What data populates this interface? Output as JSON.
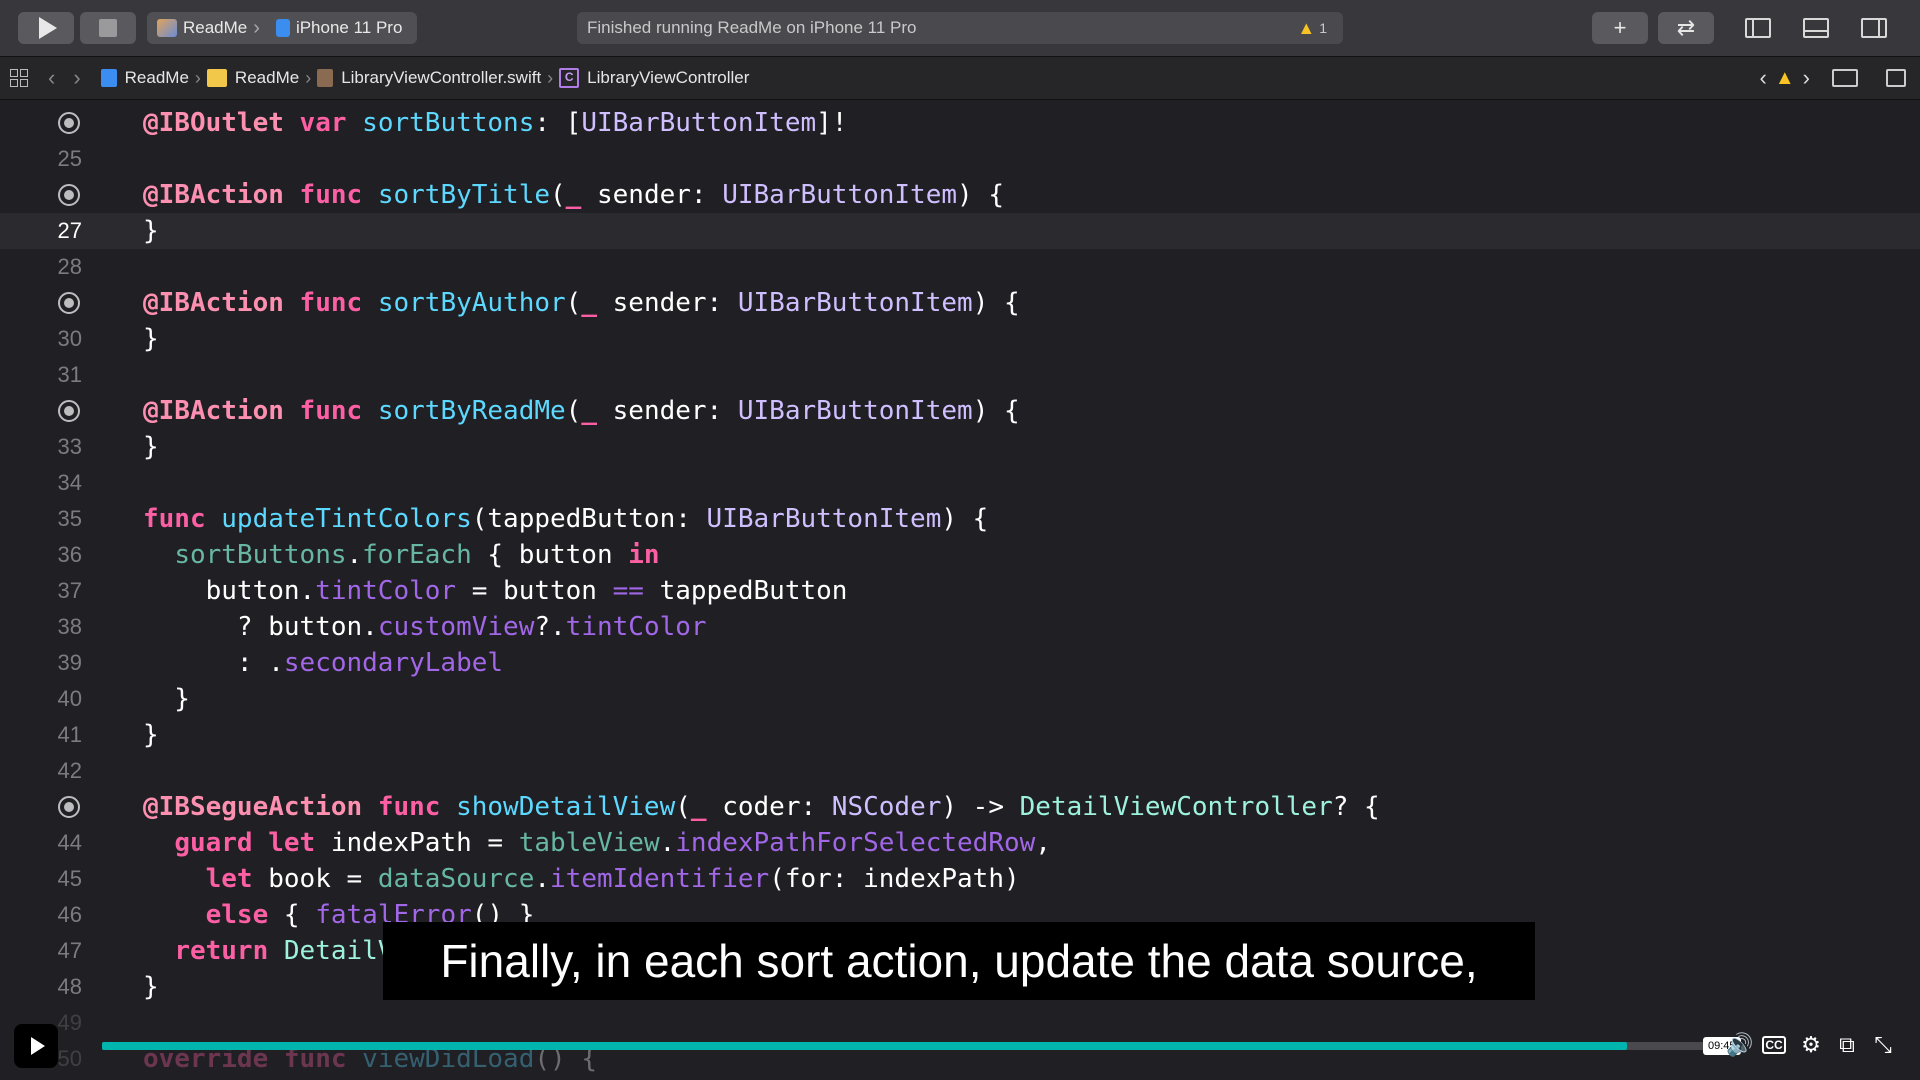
{
  "toolbar": {
    "scheme_project": "ReadMe",
    "scheme_device": "iPhone 11 Pro",
    "status_text": "Finished running ReadMe on iPhone 11 Pro",
    "warning_count": "1",
    "add_label": "+",
    "swap_label": "⇄"
  },
  "jumpbar": {
    "crumbs": [
      "ReadMe",
      "ReadMe",
      "LibraryViewController.swift",
      "LibraryViewController"
    ],
    "class_badge": "C"
  },
  "editor": {
    "line_numbers": [
      "",
      "25",
      "",
      "27",
      "28",
      "",
      "30",
      "31",
      "",
      "33",
      "34",
      "35",
      "36",
      "37",
      "38",
      "39",
      "40",
      "41",
      "42",
      "",
      "44",
      "45",
      "46",
      "47",
      "48",
      "49",
      "50"
    ],
    "current_line": "27"
  },
  "caption": {
    "text": "Finally, in each sort action, update the data source,"
  },
  "video": {
    "time": "09:45",
    "progress": 0.945,
    "accent_color": "#00b5ad"
  }
}
